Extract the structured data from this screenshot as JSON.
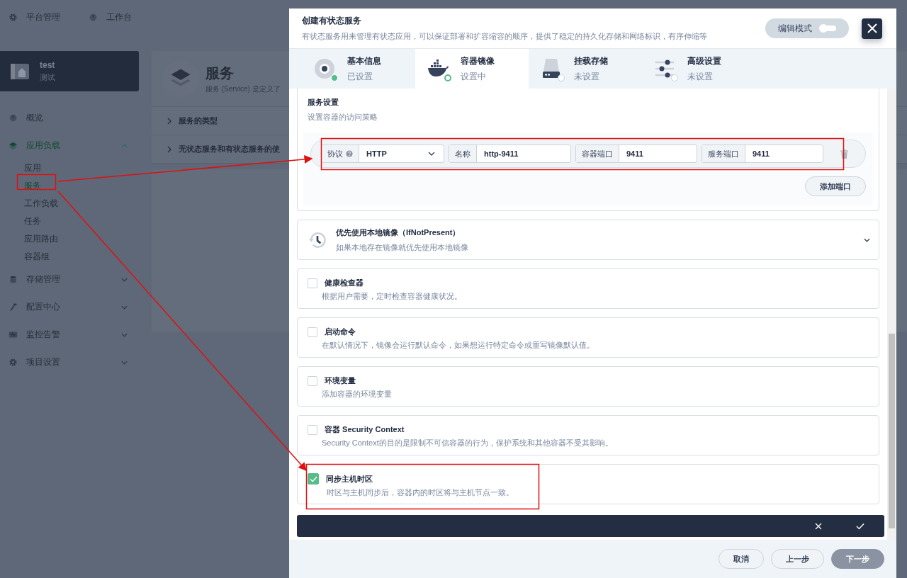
{
  "topbar": [
    {
      "label": "平台管理"
    },
    {
      "label": "工作台"
    }
  ],
  "project": {
    "name": "test",
    "alias": "测试"
  },
  "nav": [
    {
      "label": "概览",
      "kind": "link",
      "selected": false
    },
    {
      "label": "应用负载",
      "kind": "group",
      "selected": true,
      "expanded": true,
      "children": [
        {
          "label": "应用",
          "selected": false
        },
        {
          "label": "服务",
          "selected": true
        },
        {
          "label": "工作负载",
          "selected": false
        },
        {
          "label": "任务",
          "selected": false
        },
        {
          "label": "应用路由",
          "selected": false
        },
        {
          "label": "容器组",
          "selected": false
        }
      ]
    },
    {
      "label": "存储管理",
      "kind": "group",
      "selected": false,
      "expanded": false
    },
    {
      "label": "配置中心",
      "kind": "group",
      "selected": false,
      "expanded": false
    },
    {
      "label": "监控告警",
      "kind": "group",
      "selected": false,
      "expanded": false
    },
    {
      "label": "项目设置",
      "kind": "group",
      "selected": false,
      "expanded": false
    }
  ],
  "page": {
    "title": "服务",
    "description": "服务 (Service) 是定义了",
    "sections": [
      {
        "label": "服务的类型"
      },
      {
        "label": "无状态服务和有状态服务的使"
      }
    ]
  },
  "modal": {
    "title": "创建有状态服务",
    "description": "有状态服务用来管理有状态应用，可以保证部署和扩容缩容的顺序，提供了稳定的持久化存储和网络标识，有序伸缩等",
    "edit_mode": {
      "label": "编辑模式",
      "on": false
    },
    "steps": [
      {
        "title": "基本信息",
        "status_text": "已设置",
        "completed": true,
        "kind": "info",
        "selected": false
      },
      {
        "title": "容器镜像",
        "status_text": "设置中",
        "completed": false,
        "kind": "container",
        "selected": true
      },
      {
        "title": "挂载存储",
        "status_text": "未设置",
        "completed": false,
        "kind": "storage",
        "selected": false
      },
      {
        "title": "高级设置",
        "status_text": "未设置",
        "completed": false,
        "kind": "settings",
        "selected": false
      }
    ],
    "service_settings": {
      "title": "服务设置",
      "description": "设置容器的访问策略",
      "ports": [
        {
          "protocol_label": "协议",
          "protocol": "HTTP",
          "name_label": "名称",
          "name": "http-9411",
          "container_port_label": "容器端口",
          "container_port": "9411",
          "service_port_label": "服务端口",
          "service_port": "9411"
        }
      ],
      "add_button": "添加端口"
    },
    "pull_policy": {
      "title": "优先使用本地镜像（IfNotPresent）",
      "description": "如果本地存在镜像就优先使用本地镜像",
      "expanded": false
    },
    "options": [
      {
        "title": "健康检查器",
        "description": "根据用户需要，定时检查容器健康状况。",
        "checked": false
      },
      {
        "title": "启动命令",
        "description": "在默认情况下，镜像会运行默认命令，如果想运行特定命令或重写镜像默认值。",
        "checked": false
      },
      {
        "title": "环境变量",
        "description": "添加容器的环境变量",
        "checked": false
      },
      {
        "title": "容器 Security Context",
        "description": "Security Context的目的是限制不可信容器的行为，保护系统和其他容器不受其影响。",
        "checked": false
      },
      {
        "title": "同步主机时区",
        "description": "时区与主机同步后，容器内的时区将与主机节点一致。",
        "checked": true
      }
    ],
    "actions": [
      {
        "label": "取消",
        "kind": "default"
      },
      {
        "label": "上一步",
        "kind": "default"
      },
      {
        "label": "下一步",
        "kind": "primary"
      }
    ]
  }
}
